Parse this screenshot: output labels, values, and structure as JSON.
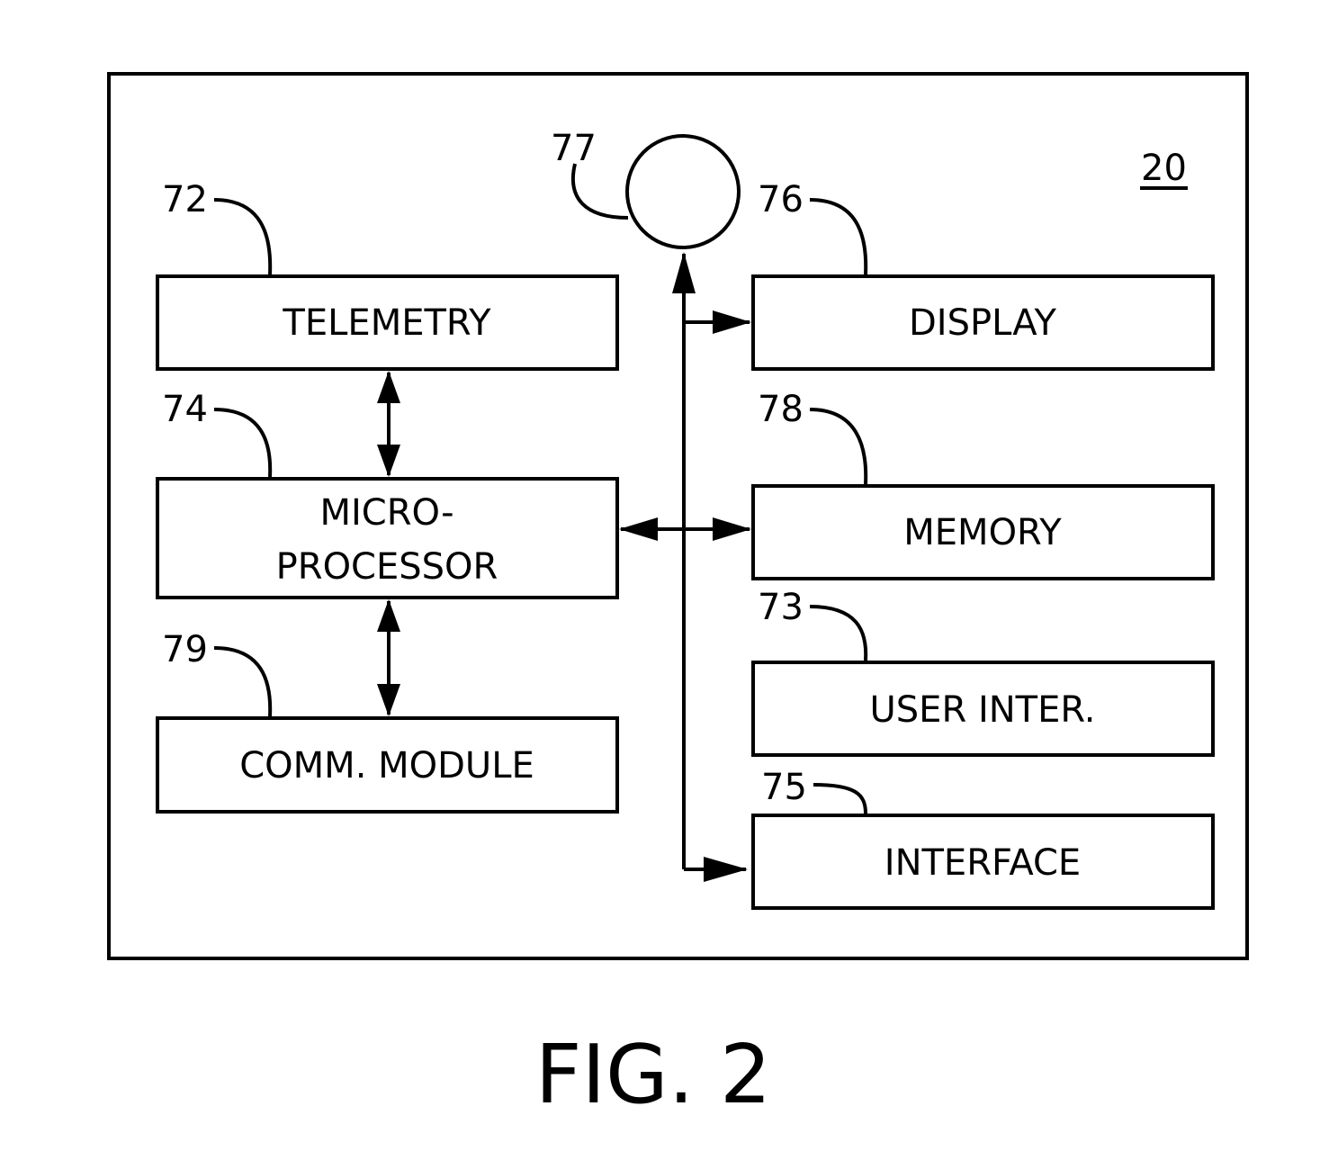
{
  "figure": {
    "caption": "FIG. 2",
    "device_ref": "20"
  },
  "blocks": {
    "telemetry": {
      "label": "TELEMETRY",
      "ref": "72"
    },
    "microprocessor": {
      "label_line1": "MICRO-",
      "label_line2": "PROCESSOR",
      "ref": "74"
    },
    "comm_module": {
      "label": "COMM. MODULE",
      "ref": "79"
    },
    "display": {
      "label": "DISPLAY",
      "ref": "76"
    },
    "memory": {
      "label": "MEMORY",
      "ref": "78"
    },
    "user_interface": {
      "label": "USER INTER.",
      "ref": "73"
    },
    "interface": {
      "label": "INTERFACE",
      "ref": "75"
    },
    "circle_component": {
      "ref": "77"
    }
  }
}
